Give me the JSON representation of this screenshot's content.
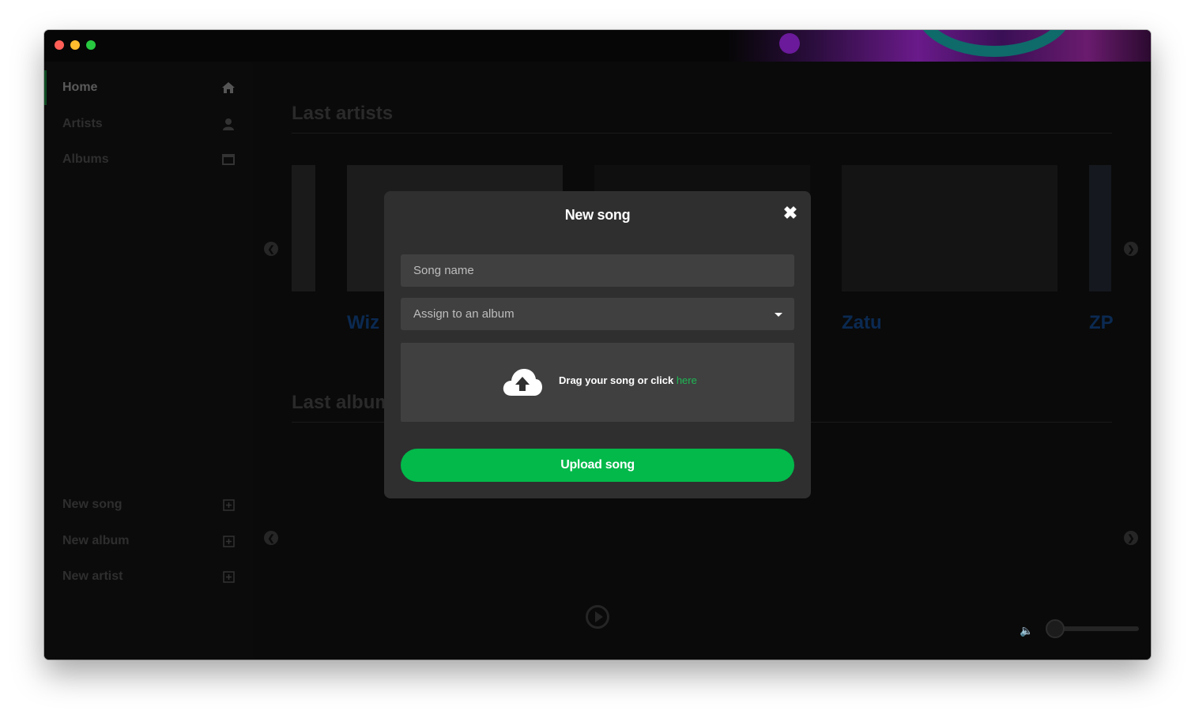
{
  "window": {
    "traffic_lights": [
      "close",
      "minimize",
      "maximize"
    ]
  },
  "sidebar": {
    "nav": [
      {
        "label": "Home",
        "icon": "home-icon"
      },
      {
        "label": "Artists",
        "icon": "user-icon"
      },
      {
        "label": "Albums",
        "icon": "album-icon"
      }
    ],
    "actions": [
      {
        "label": "New song",
        "icon": "plus-square-icon"
      },
      {
        "label": "New album",
        "icon": "plus-square-icon"
      },
      {
        "label": "New artist",
        "icon": "plus-square-icon"
      }
    ]
  },
  "main": {
    "last_artists_title": "Last artists",
    "last_albums_title": "Last albums",
    "artists": [
      "Wiz",
      "Zatu",
      "ZP"
    ]
  },
  "modal": {
    "title": "New song",
    "song_name_placeholder": "Song name",
    "album_select_value": "Assign to an album",
    "drop_text": "Drag your song or click ",
    "drop_link": "here",
    "upload_button": "Upload song"
  },
  "colors": {
    "accent": "#02b94a",
    "link": "#1db954",
    "modal_bg": "#2f2f2f",
    "field_bg": "#404040"
  }
}
